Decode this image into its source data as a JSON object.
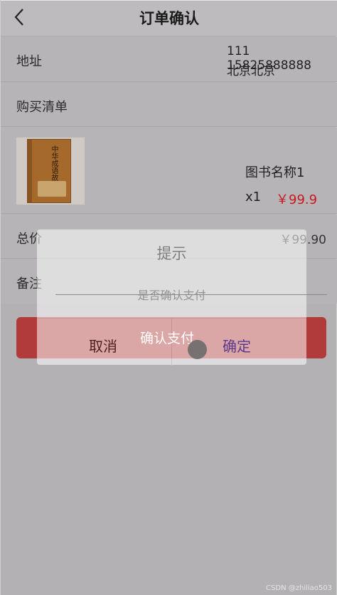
{
  "header": {
    "title": "订单确认",
    "back_icon": "chevron-left-icon"
  },
  "address": {
    "label": "地址",
    "line1": "111 15825888888",
    "line2": "北京北京"
  },
  "purchase_list": {
    "label": "购买清单"
  },
  "product": {
    "cover_title": "中华成语故事",
    "name": "图书名称1",
    "quantity": "x1",
    "price": "￥99.9",
    "price_color": "#c8171e"
  },
  "total": {
    "label": "总价",
    "value": "￥99.90"
  },
  "remark": {
    "label": "备注"
  },
  "pay_button": {
    "label": "确认支付",
    "color": "#b13b3a"
  },
  "dialog": {
    "title": "提示",
    "message": "是否确认支付",
    "cancel_label": "取消",
    "confirm_label": "确定"
  },
  "watermark": "CSDN @zhiliao503"
}
